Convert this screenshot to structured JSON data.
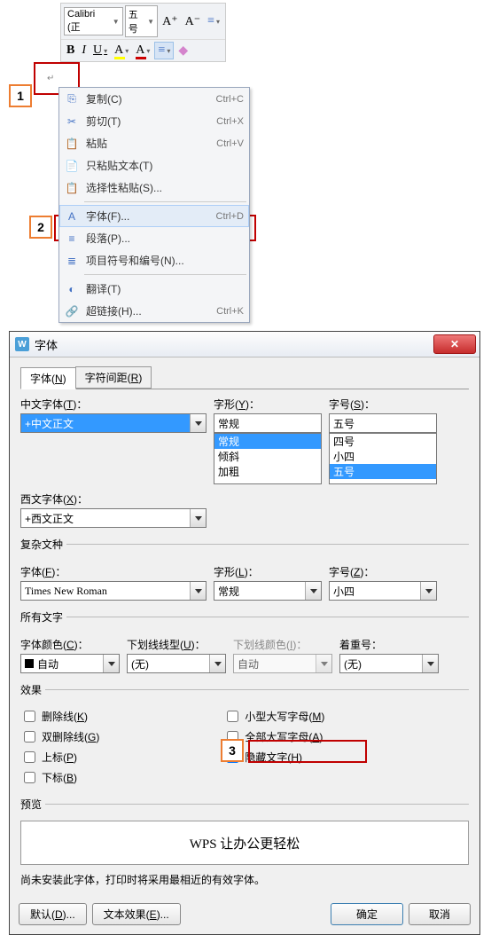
{
  "toolbar": {
    "font_name": "Calibri (正",
    "font_size": "五号",
    "grow": "A⁺",
    "shrink": "A⁻",
    "bold": "B",
    "italic": "I",
    "underline": "U",
    "erase": "◆"
  },
  "callout1": "1",
  "callout2": "2",
  "callout3": "3",
  "paragraph_marker": "↵",
  "context_menu": [
    {
      "icon": "⎘",
      "label": "复制(C)",
      "shortcut": "Ctrl+C"
    },
    {
      "icon": "✂",
      "label": "剪切(T)",
      "shortcut": "Ctrl+X"
    },
    {
      "icon": "📋",
      "label": "粘贴",
      "shortcut": "Ctrl+V"
    },
    {
      "icon": "📄",
      "label": "只粘贴文本(T)",
      "shortcut": ""
    },
    {
      "icon": "📋",
      "label": "选择性粘贴(S)...",
      "shortcut": ""
    },
    {
      "sep": true
    },
    {
      "icon": "A",
      "label": "字体(F)...",
      "shortcut": "Ctrl+D",
      "selected": true
    },
    {
      "icon": "≡",
      "label": "段落(P)...",
      "shortcut": ""
    },
    {
      "icon": "≣",
      "label": "项目符号和编号(N)...",
      "shortcut": ""
    },
    {
      "sep": true
    },
    {
      "icon": "◐",
      "label": "翻译(T)",
      "shortcut": ""
    },
    {
      "icon": "🔗",
      "label": "超链接(H)...",
      "shortcut": "Ctrl+K"
    }
  ],
  "dialog": {
    "title": "字体",
    "tabs": {
      "font": "字体(N)",
      "spacing": "字符间距(R)"
    },
    "chinese_font": {
      "label": "中文字体(T)：",
      "value": "+中文正文"
    },
    "style": {
      "label": "字形(Y)：",
      "value": "常规",
      "options": [
        "常规",
        "倾斜",
        "加粗"
      ]
    },
    "size": {
      "label": "字号(S)：",
      "value": "五号",
      "options": [
        "四号",
        "小四",
        "五号"
      ]
    },
    "western_font": {
      "label": "西文字体(X)：",
      "value": "+西文正文"
    },
    "complex": {
      "legend": "复杂文种",
      "font": {
        "label": "字体(F)：",
        "value": "Times New Roman"
      },
      "style": {
        "label": "字形(L)：",
        "value": "常规"
      },
      "size": {
        "label": "字号(Z)：",
        "value": "小四"
      }
    },
    "all_text": {
      "legend": "所有文字",
      "color": {
        "label": "字体颜色(C)：",
        "value": "自动"
      },
      "under_style": {
        "label": "下划线线型(U)：",
        "value": "(无)"
      },
      "under_color": {
        "label": "下划线颜色(I)：",
        "value": "自动"
      },
      "emphasis": {
        "label": "着重号：",
        "value": "(无)"
      }
    },
    "effects": {
      "legend": "效果",
      "left": [
        {
          "label": "删除线(K)",
          "checked": false
        },
        {
          "label": "双删除线(G)",
          "checked": false
        },
        {
          "label": "上标(P)",
          "checked": false
        },
        {
          "label": "下标(B)",
          "checked": false
        }
      ],
      "right": [
        {
          "label": "小型大写字母(M)",
          "checked": false
        },
        {
          "label": "全部大写字母(A)",
          "checked": false
        },
        {
          "label": "隐藏文字(H)",
          "checked": true
        }
      ]
    },
    "preview": {
      "legend": "预览",
      "text": "WPS 让办公更轻松"
    },
    "note": "尚未安装此字体，打印时将采用最相近的有效字体。",
    "buttons": {
      "default": "默认(D)...",
      "text_fx": "文本效果(E)...",
      "ok": "确定",
      "cancel": "取消"
    }
  }
}
